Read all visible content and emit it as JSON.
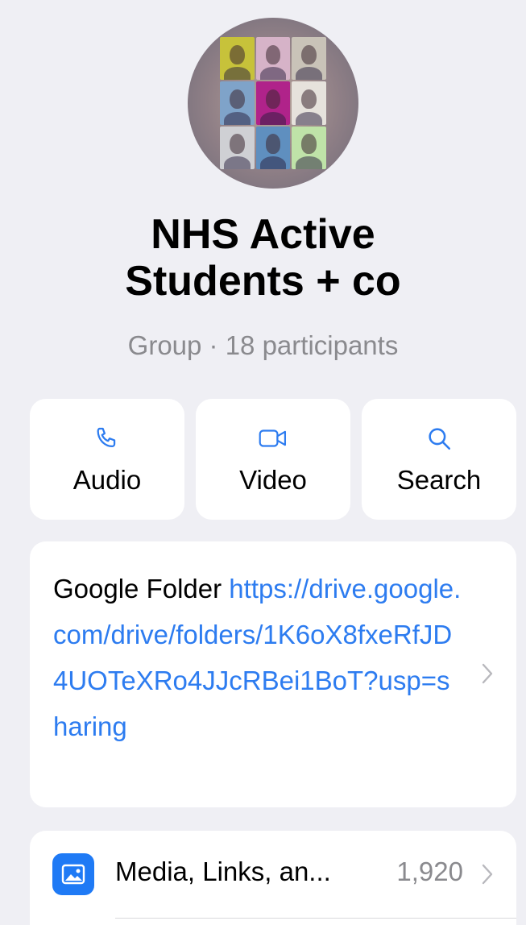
{
  "group": {
    "title": "NHS Active Students + co",
    "subtitle": "Group · 18 participants",
    "avatar_tiles": [
      "#c7c23a",
      "#d6b3c8",
      "#c9c3b8",
      "#7fa3c9",
      "#b0238a",
      "#e6e2dc",
      "#cfd0d4",
      "#5f8fbf",
      "#bfe3a8"
    ]
  },
  "actions": [
    {
      "label": "Audio",
      "icon": "phone-icon"
    },
    {
      "label": "Video",
      "icon": "video-camera-icon"
    },
    {
      "label": "Search",
      "icon": "search-icon"
    }
  ],
  "description": {
    "prefix": "Google Folder ",
    "link": "https://drive.google.com/drive/folders/1K6oX8fxeRfJD4UOTeXRo4JJcRBei1BoT?usp=sharing"
  },
  "media": {
    "label": "Media, Links, an...",
    "count": "1,920",
    "icon": "photo-icon"
  },
  "colors": {
    "accent": "#2d7cf0",
    "background": "#efeff4",
    "secondary_text": "#8a8a8e"
  }
}
